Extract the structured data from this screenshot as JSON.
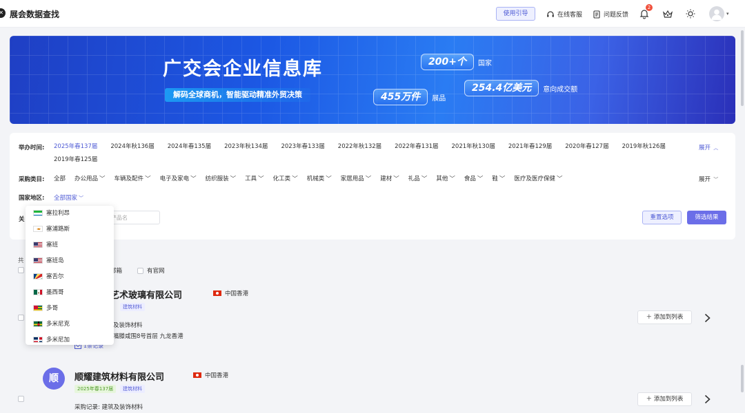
{
  "header": {
    "title": "展会数据查找",
    "guide_label": "使用引导",
    "service_label": "在线客服",
    "feedback_label": "问题反馈",
    "notification_count": "2"
  },
  "banner": {
    "title": "广交会企业信息库",
    "subtitle": "解码全球商机，智能驱动精准外贸决策",
    "stats": [
      {
        "value": "200+个",
        "unit": "国家"
      },
      {
        "value": "455万件",
        "unit": "展品"
      },
      {
        "value": "254.4亿美元",
        "unit": "意向成交额"
      }
    ]
  },
  "filters": {
    "time_label": "举办时间:",
    "years": [
      "2025年春137届",
      "2024年秋136届",
      "2024年春135届",
      "2023年秋134届",
      "2023年春133届",
      "2022年秋132届",
      "2022年春131届",
      "2021年秋130届",
      "2021年春129届",
      "2020年春127届",
      "2019年秋126届",
      "2019年春125届"
    ],
    "selected_year": "2025年春137届",
    "expand_label": "展开",
    "category_label": "采购类目:",
    "categories": [
      "全部",
      "办公用品",
      "车辆及配件",
      "电子及家电",
      "纺织服装",
      "工具",
      "化工类",
      "机械类",
      "家居用品",
      "建材",
      "礼品",
      "其他",
      "食品",
      "鞋",
      "医疗及医疗保健"
    ],
    "country_label": "国家地区:",
    "country_value": "全部国家",
    "keyword_label": "关",
    "keyword_placeholder": "产品名",
    "reset_label": "重置选项",
    "submit_label": "筛选结果"
  },
  "results": {
    "count_label": "共",
    "option_email": "邮箱",
    "option_website": "有官网",
    "add_label": "添加到列表",
    "companies": [
      {
        "name": "艺术玻璃有限公司",
        "region": "中国香港",
        "tag": "建筑材料",
        "purchase": "及装饰材料",
        "address": "嘴滕咸围8号首层 九龙香港",
        "records": "1条记录"
      },
      {
        "avatar_char": "顺",
        "name": "顺耀建筑材料有限公司",
        "region": "中国香港",
        "session_tag": "2025年春137届",
        "tag": "建筑材料",
        "purchase": "采购记录: 建筑及装饰材料"
      }
    ]
  },
  "dropdown": {
    "items": [
      {
        "name": "塞拉利昂",
        "flag": "sierra-leone-flag"
      },
      {
        "name": "塞浦路斯",
        "flag": "cyprus-flag"
      },
      {
        "name": "塞班",
        "flag": "us-flag"
      },
      {
        "name": "塞班岛",
        "flag": "us-flag"
      },
      {
        "name": "塞舌尔",
        "flag": "seychelles-flag"
      },
      {
        "name": "墨西哥",
        "flag": "mexico-flag"
      },
      {
        "name": "多哥",
        "flag": "togo-flag"
      },
      {
        "name": "多米尼克",
        "flag": "dominica-flag"
      },
      {
        "name": "多米尼加",
        "flag": "dominican-republic-flag"
      }
    ]
  },
  "colors": {
    "accent": "#4f5bd5",
    "primary_button": "#6b6ee8",
    "banner_blue": "#1c58e4"
  }
}
